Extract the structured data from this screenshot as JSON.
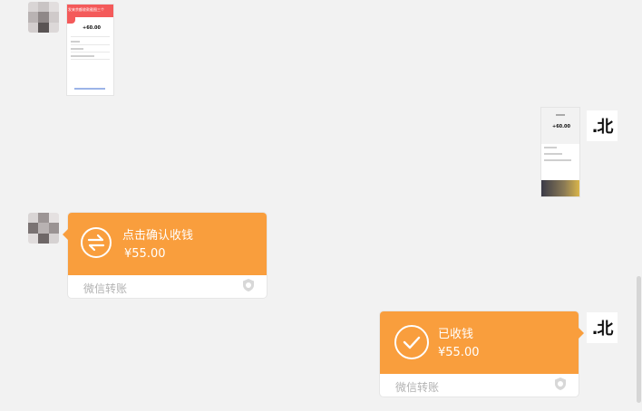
{
  "messages": [
    {
      "side": "left",
      "type": "image",
      "image": {
        "banner": "发来余额收款截图三个",
        "amount": "+60.00"
      }
    },
    {
      "side": "right",
      "type": "image",
      "image": {
        "amount": "+60.00"
      }
    },
    {
      "side": "left",
      "type": "transfer",
      "title": "点击确认收钱",
      "amount": "¥55.00",
      "footer": "微信转账",
      "icon": "transfer-arrows-icon"
    },
    {
      "side": "right",
      "type": "transfer",
      "title": "已收钱",
      "amount": "¥55.00",
      "footer": "微信转账",
      "icon": "checkmark-icon"
    }
  ],
  "avatars": {
    "right_text": ".北"
  },
  "colors": {
    "transfer_orange": "#f99e3d",
    "chat_background": "#f2f2f2",
    "footer_text": "#b2b2b2"
  }
}
